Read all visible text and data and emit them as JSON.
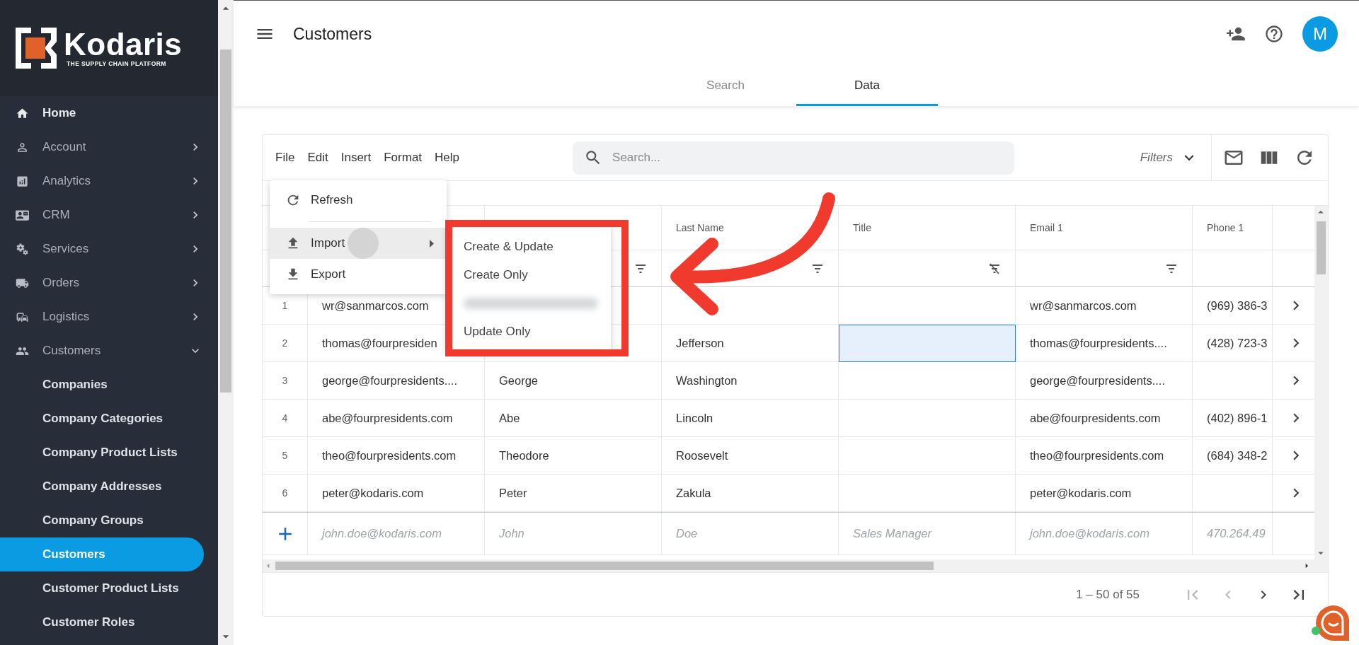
{
  "logo": {
    "name": "Kodaris",
    "tagline": "THE SUPPLY CHAIN PLATFORM"
  },
  "sidebar": {
    "items": [
      {
        "label": "Home",
        "has_arrow": false,
        "expanded": false,
        "bright": true
      },
      {
        "label": "Account",
        "has_arrow": true,
        "expanded": false,
        "bright": false
      },
      {
        "label": "Analytics",
        "has_arrow": true,
        "expanded": false,
        "bright": false
      },
      {
        "label": "CRM",
        "has_arrow": true,
        "expanded": false,
        "bright": false
      },
      {
        "label": "Services",
        "has_arrow": true,
        "expanded": false,
        "bright": false
      },
      {
        "label": "Orders",
        "has_arrow": true,
        "expanded": false,
        "bright": false
      },
      {
        "label": "Logistics",
        "has_arrow": true,
        "expanded": false,
        "bright": false
      },
      {
        "label": "Customers",
        "has_arrow": true,
        "expanded": true,
        "bright": false,
        "children": [
          {
            "label": "Companies",
            "selected": false
          },
          {
            "label": "Company Categories",
            "selected": false
          },
          {
            "label": "Company Product Lists",
            "selected": false
          },
          {
            "label": "Company Addresses",
            "selected": false
          },
          {
            "label": "Company Groups",
            "selected": false
          },
          {
            "label": "Customers",
            "selected": true
          },
          {
            "label": "Customer Product Lists",
            "selected": false
          },
          {
            "label": "Customer Roles",
            "selected": false
          }
        ]
      }
    ]
  },
  "header": {
    "title": "Customers",
    "avatar": "M"
  },
  "tabs": [
    {
      "label": "Search",
      "selected": false
    },
    {
      "label": "Data",
      "selected": true
    }
  ],
  "toolbar": {
    "menus": [
      "File",
      "Edit",
      "Insert",
      "Format",
      "Help"
    ],
    "search_placeholder": "Search...",
    "filters": "Filters"
  },
  "file_menu": {
    "items": [
      {
        "label": "Refresh",
        "kind": "refresh",
        "hovered": false
      },
      {
        "kind": "divider"
      },
      {
        "label": "Import",
        "kind": "import",
        "hovered": true
      },
      {
        "label": "Export",
        "kind": "export",
        "hovered": false
      }
    ]
  },
  "import_submenu": {
    "items": [
      {
        "label": "Create & Update",
        "kind": "text"
      },
      {
        "label": "Create Only",
        "kind": "text"
      },
      {
        "kind": "blurred"
      },
      {
        "label": "Update Only",
        "kind": "text"
      }
    ]
  },
  "table": {
    "columns": [
      "Last Name",
      "Title",
      "Email 1",
      "Phone 1"
    ],
    "rows": [
      {
        "number": "1",
        "email": "wr@sanmarcos.com",
        "email_1": "wr@sanmarcos.com",
        "phone_1": "(969) 386-3",
        "title_selected": false
      },
      {
        "number": "2",
        "email": "thomas@fourpresiden",
        "last_name": "Jefferson",
        "email_1": "thomas@fourpresidents....",
        "phone_1": "(428) 723-3",
        "title_selected": true
      },
      {
        "number": "3",
        "email": "george@fourpresidents....",
        "first_name": "George",
        "last_name": "Washington",
        "email_1": "george@fourpresidents....",
        "title_selected": false
      },
      {
        "number": "4",
        "email": "abe@fourpresidents.com",
        "first_name": "Abe",
        "last_name": "Lincoln",
        "email_1": "abe@fourpresidents.com",
        "phone_1": "(402) 896-1",
        "title_selected": false
      },
      {
        "number": "5",
        "email": "theo@fourpresidents.com",
        "first_name": "Theodore",
        "last_name": "Roosevelt",
        "email_1": "theo@fourpresidents.com",
        "phone_1": "(684) 348-2",
        "title_selected": false
      },
      {
        "number": "6",
        "email": "peter@kodaris.com",
        "first_name": "Peter",
        "last_name": "Zakula",
        "email_1": "peter@kodaris.com",
        "title_selected": false
      }
    ],
    "new_row": {
      "email": "john.doe@kodaris.com",
      "first_name": "John",
      "last_name": "Doe",
      "title": "Sales Manager",
      "email_1": "john.doe@kodaris.com",
      "phone_1": "470.264.49"
    }
  },
  "pagination": {
    "range": "1 – 50 of 55",
    "buttons": [
      {
        "kind": "first",
        "disabled": true
      },
      {
        "kind": "prev",
        "disabled": true
      },
      {
        "kind": "next",
        "disabled": false
      },
      {
        "kind": "last",
        "disabled": false
      }
    ]
  }
}
